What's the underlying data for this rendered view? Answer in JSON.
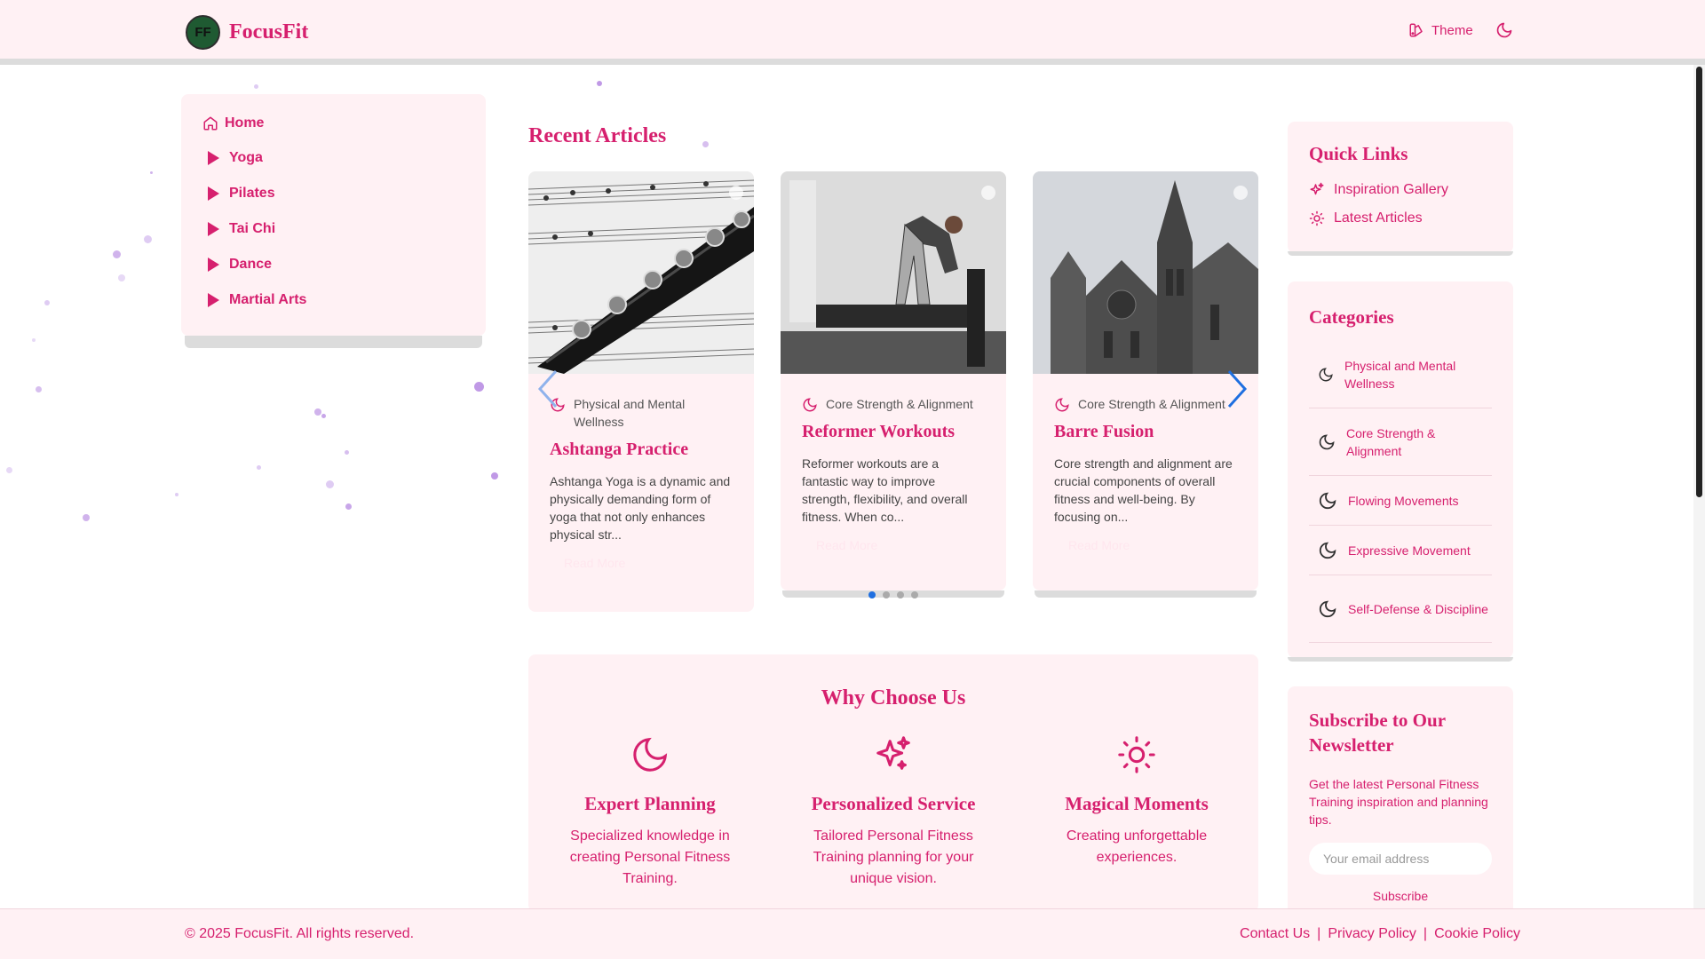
{
  "header": {
    "logo_initials": "FF",
    "brand": "FocusFit",
    "theme_label": "Theme"
  },
  "left_nav": {
    "home": "Home",
    "items": [
      {
        "label": "Yoga"
      },
      {
        "label": "Pilates"
      },
      {
        "label": "Tai Chi"
      },
      {
        "label": "Dance"
      },
      {
        "label": "Martial Arts"
      }
    ]
  },
  "articles": {
    "title": "Recent Articles",
    "cards": [
      {
        "category": "Physical and Mental Wellness",
        "title": "Ashtanga Practice",
        "excerpt": "Ashtanga Yoga is a dynamic and physically demanding form of yoga that not only enhances physical str...",
        "read_more": "Read More"
      },
      {
        "category": "Core Strength & Alignment",
        "title": "Reformer Workouts",
        "excerpt": "Reformer workouts are a fantastic way to improve strength, flexibility, and overall fitness. When co...",
        "read_more": "Read More"
      },
      {
        "category": "Core Strength & Alignment",
        "title": "Barre Fusion",
        "excerpt": "Core strength and alignment are crucial components of overall fitness and well-being. By focusing on...",
        "read_more": "Read More"
      }
    ],
    "active_slide": 1,
    "slide_count": 4
  },
  "why": {
    "title": "Why Choose Us",
    "items": [
      {
        "icon": "moon-icon",
        "title": "Expert Planning",
        "text": "Specialized knowledge in creating Personal Fitness Training."
      },
      {
        "icon": "sparkles-icon",
        "title": "Personalized Service",
        "text": "Tailored Personal Fitness Training planning for your unique vision."
      },
      {
        "icon": "sun-icon",
        "title": "Magical Moments",
        "text": "Creating unforgettable experiences."
      }
    ]
  },
  "quick_links": {
    "title": "Quick Links",
    "items": [
      {
        "icon": "sparkles-icon",
        "label": "Inspiration Gallery"
      },
      {
        "icon": "sun-icon",
        "label": "Latest Articles"
      }
    ]
  },
  "categories": {
    "title": "Categories",
    "items": [
      {
        "label": "Physical and Mental Wellness"
      },
      {
        "label": "Core Strength & Alignment"
      },
      {
        "label": "Flowing Movements"
      },
      {
        "label": "Expressive Movement"
      },
      {
        "label": "Self-Defense & Discipline"
      }
    ]
  },
  "newsletter": {
    "title": "Subscribe to Our Newsletter",
    "text": "Get the latest Personal Fitness Training inspiration and planning tips.",
    "placeholder": "Your email address",
    "button": "Subscribe"
  },
  "footer": {
    "copyright": "© 2025 FocusFit. All rights reserved.",
    "links": [
      {
        "label": "Contact Us"
      },
      {
        "label": "Privacy Policy"
      },
      {
        "label": "Cookie Policy"
      }
    ],
    "separator": "|"
  },
  "colors": {
    "accent": "#d6206e",
    "panel": "#fff1f4",
    "carousel_dot_active": "#1e6fe0"
  }
}
